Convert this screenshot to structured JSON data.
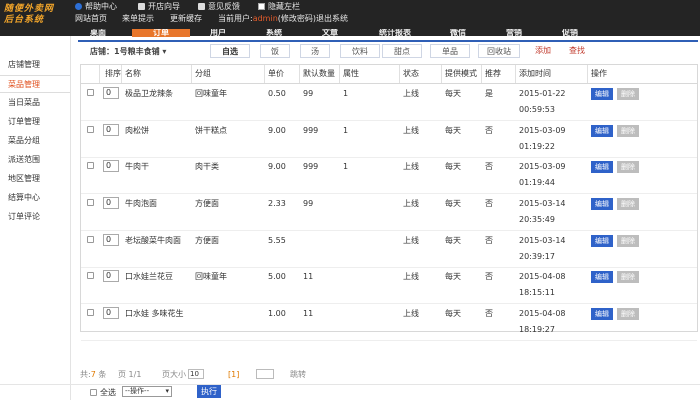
{
  "app": {
    "logo_line1": "随便外卖网",
    "logo_line2": "后台系统"
  },
  "topbar": {
    "help": "帮助中心",
    "guide": "开店向导",
    "feedback": "意见反馈",
    "hide_sidebar": "隐藏左栏",
    "home": "网站首页",
    "preview": "来单提示",
    "cache": "更新缓存",
    "user_label": "当前用户:",
    "user_name": "admin",
    "change_pwd": "(修改密码)",
    "logout": "退出系统"
  },
  "tabs": [
    "桌面",
    "订单",
    "用户",
    "系统",
    "文章",
    "统计报表",
    "微信",
    "营销",
    "促销"
  ],
  "active_tab": "订单",
  "sidebar": {
    "items": [
      "店铺管理",
      "菜品管理",
      "当日菜品",
      "订单管理",
      "菜品分组",
      "派送范围",
      "地区管理",
      "结算中心",
      "订单评论"
    ],
    "active": "菜品管理"
  },
  "filter": {
    "store_label": "店铺：",
    "store_value": "1号粮丰食铺",
    "buttons": [
      "自选",
      "饭",
      "汤",
      "饮料",
      "甜点",
      "单品",
      "回收站"
    ],
    "selected": "自选",
    "add": "添加",
    "search": "查找"
  },
  "table": {
    "headers": [
      "排序",
      "名称",
      "分组",
      "单价",
      "默认数量",
      "属性",
      "状态",
      "提供模式",
      "推荐",
      "添加时间",
      "操作"
    ],
    "edit_label": "编辑",
    "delete_label": "删除",
    "rows": [
      {
        "sort": "0",
        "name": "极品卫龙辣条",
        "group": "回味童年",
        "price": "0.50",
        "qty": "99",
        "attr": "1",
        "status": "上线",
        "mode": "每天",
        "rec": "是",
        "date": "2015-01-22",
        "time": "00:59:53"
      },
      {
        "sort": "0",
        "name": "肉松饼",
        "group": "饼干糕点",
        "price": "9.00",
        "qty": "999",
        "attr": "1",
        "status": "上线",
        "mode": "每天",
        "rec": "否",
        "date": "2015-03-09",
        "time": "01:19:22"
      },
      {
        "sort": "0",
        "name": "牛肉干",
        "group": "肉干类",
        "price": "9.00",
        "qty": "999",
        "attr": "1",
        "status": "上线",
        "mode": "每天",
        "rec": "否",
        "date": "2015-03-09",
        "time": "01:19:44"
      },
      {
        "sort": "0",
        "name": "牛肉泡面",
        "group": "方便面",
        "price": "2.33",
        "qty": "99",
        "attr": "",
        "status": "上线",
        "mode": "每天",
        "rec": "否",
        "date": "2015-03-14",
        "time": "20:35:49"
      },
      {
        "sort": "0",
        "name": "老坛酸菜牛肉面",
        "group": "方便面",
        "price": "5.55",
        "qty": "",
        "attr": "",
        "status": "上线",
        "mode": "每天",
        "rec": "否",
        "date": "2015-03-14",
        "time": "20:39:17"
      },
      {
        "sort": "0",
        "name": "口水娃兰花豆",
        "group": "回味童年",
        "price": "5.00",
        "qty": "11",
        "attr": "",
        "status": "上线",
        "mode": "每天",
        "rec": "否",
        "date": "2015-04-08",
        "time": "18:15:11"
      },
      {
        "sort": "0",
        "name": "口水娃 多味花生",
        "group": "",
        "price": "1.00",
        "qty": "11",
        "attr": "",
        "status": "上线",
        "mode": "每天",
        "rec": "否",
        "date": "2015-04-08",
        "time": "18:19:27"
      }
    ]
  },
  "pager": {
    "total_prefix": "共:",
    "total": "7",
    "total_suffix": "条",
    "pages": "页 1/1",
    "page_size_label": "页大小",
    "page_size": "10",
    "current": "[1]",
    "jump": "跳转"
  },
  "bottom": {
    "select_all": "全选",
    "action_placeholder": "--操作--",
    "execute": "执行"
  }
}
